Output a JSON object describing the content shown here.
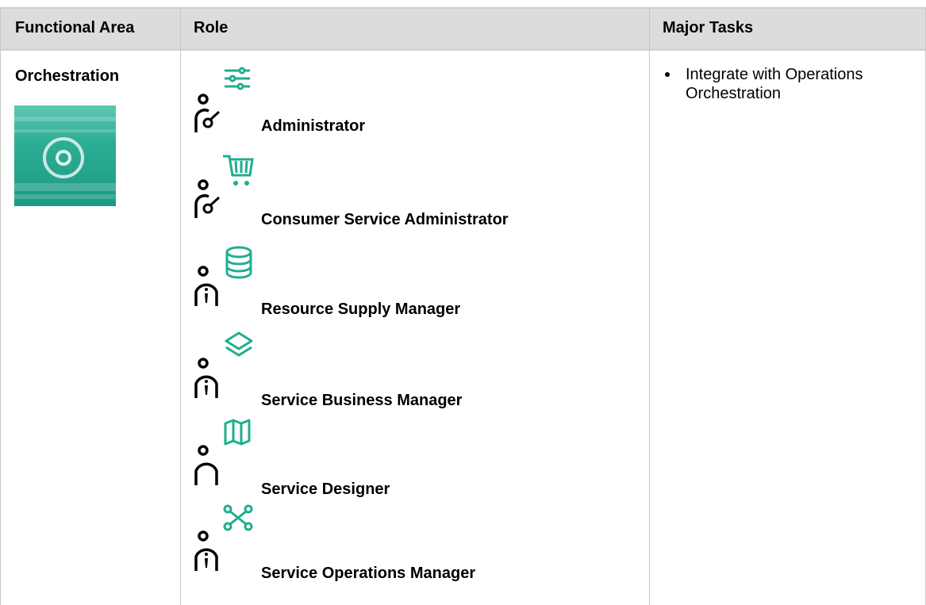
{
  "table": {
    "headers": [
      "Functional Area",
      "Role",
      "Major Tasks"
    ],
    "functional_area": "Orchestration",
    "functional_area_image_icon": "orchestration-gear-cycle",
    "roles": [
      {
        "name": "Administrator",
        "person_icon": "person-dial-icon",
        "badge_icon": "sliders-icon"
      },
      {
        "name": "Consumer Service Administrator",
        "person_icon": "person-dial-icon",
        "badge_icon": "cart-icon"
      },
      {
        "name": "Resource Supply Manager",
        "person_icon": "person-tie-icon",
        "badge_icon": "database-icon"
      },
      {
        "name": "Service Business Manager",
        "person_icon": "person-tie-icon",
        "badge_icon": "layers-icon"
      },
      {
        "name": "Service Designer",
        "person_icon": "person-plain-icon",
        "badge_icon": "map-icon"
      },
      {
        "name": "Service Operations Manager",
        "person_icon": "person-tie-icon",
        "badge_icon": "network-icon"
      }
    ],
    "major_tasks": [
      "Integrate with Operations Orchestration"
    ]
  },
  "colors": {
    "accent": "#1fae90",
    "header_bg": "#dcdcdc",
    "border": "#c8c8c8"
  }
}
